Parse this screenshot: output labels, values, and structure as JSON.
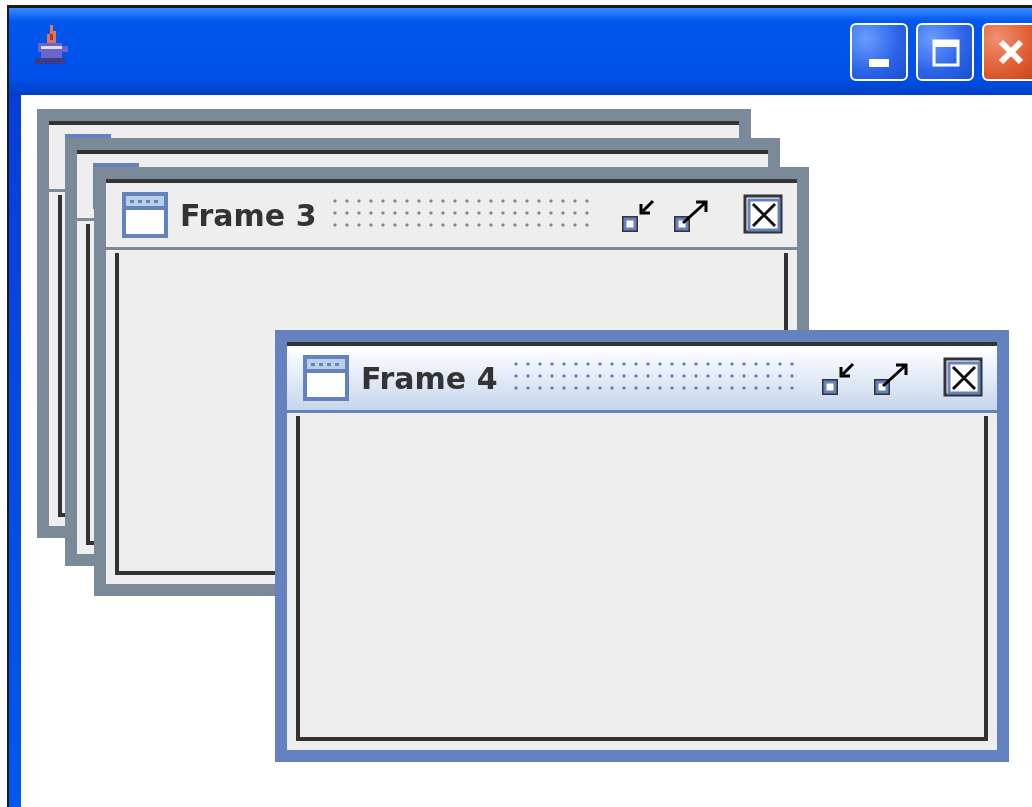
{
  "frames": [
    {
      "selected": false
    },
    {
      "selected": false
    },
    {
      "title": "Frame 3",
      "selected": false
    },
    {
      "title": "Frame 4",
      "selected": true
    }
  ]
}
